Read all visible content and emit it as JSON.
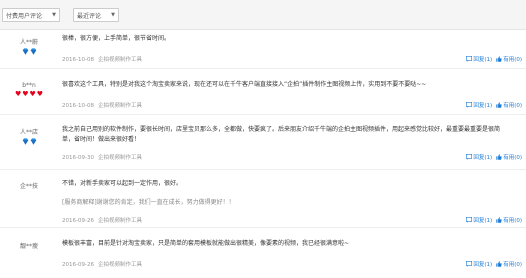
{
  "filters": {
    "type_select": "付费用户评论",
    "sort_select": "最近评论"
  },
  "reviews": [
    {
      "user": "人**蔚",
      "rank": "diamond2",
      "content": "很棒，很方便，上手简单，很节省时间。",
      "reply": "",
      "date": "2016-10-08",
      "source": "企拍视频制作工具",
      "reply_label": "回复(1)",
      "useful_label": "有用(0)"
    },
    {
      "user": "b**n",
      "rank": "heart4",
      "content": "很喜欢这个工具，特别是对我这个淘宝卖家来说，现在还可以在千牛客户端直接接入“企拍”插件制作主图视频上传，实用到不要不要哒~~",
      "reply": "",
      "date": "2016-10-08",
      "source": "企拍视频制作工具",
      "reply_label": "回复(1)",
      "useful_label": "有用(0)"
    },
    {
      "user": "人**店",
      "rank": "diamond2",
      "content": "我之前自己用别的软件制作，要很长时间，店里宝贝那么多，全都做，快要疯了。后来朋友介绍千牛端的企拍主图视频插件，用起来感觉比较好，最重要最重要是很简单，省时间！做出来很好看！",
      "reply": "",
      "date": "2016-09-30",
      "source": "企拍视频制作工具",
      "reply_label": "回复(1)",
      "useful_label": "有用(0)"
    },
    {
      "user": "企**技",
      "rank": "",
      "content": "不错，对新手卖家可以起到一定作用，很好。",
      "reply": "[服务商解释]谢谢您的肯定，我们一直在成长，努力做得更好！！",
      "date": "2016-09-26",
      "source": "企拍视频制作工具",
      "reply_label": "回复(1)",
      "useful_label": "有用(0)"
    },
    {
      "user": "靓**瘦",
      "rank": "",
      "content": "模板很丰富，目前是针对淘宝卖家，只是简单的套用模板就能做出很精美，像要素的视频，我已经很满意啦~",
      "reply": "",
      "date": "2016-09-26",
      "source": "企拍视频制作工具",
      "reply_label": "回复(1)",
      "useful_label": "有用(0)"
    }
  ]
}
